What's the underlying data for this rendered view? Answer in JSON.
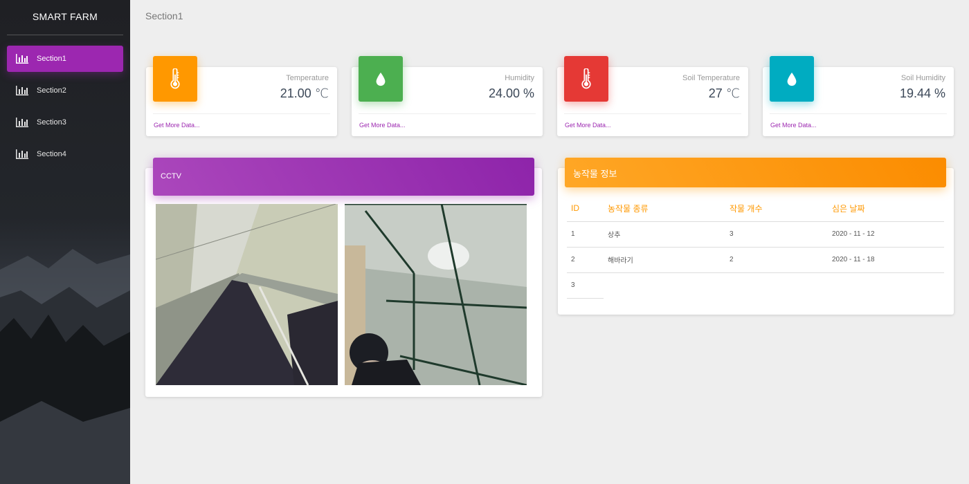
{
  "sidebar": {
    "brand": "SMART FARM",
    "items": [
      {
        "label": "Section1",
        "icon": "bar-chart-icon",
        "active": true
      },
      {
        "label": "Section2",
        "icon": "bar-chart-icon",
        "active": false
      },
      {
        "label": "Section3",
        "icon": "bar-chart-icon",
        "active": false
      },
      {
        "label": "Section4",
        "icon": "bar-chart-icon",
        "active": false
      }
    ]
  },
  "header": {
    "title": "Section1"
  },
  "stats": [
    {
      "label": "Temperature",
      "value": "21.00 ℃",
      "icon": "thermometer-icon",
      "color": "#ff9800",
      "link": "Get More Data..."
    },
    {
      "label": "Humidity",
      "value": "24.00 %",
      "icon": "water-drop-icon",
      "color": "#4caf50",
      "link": "Get More Data..."
    },
    {
      "label": "Soil Temperature",
      "value": "27 ℃",
      "icon": "thermometer-icon",
      "color": "#e53935",
      "link": "Get More Data..."
    },
    {
      "label": "Soil Humidity",
      "value": "19.44 %",
      "icon": "water-drop-icon",
      "color": "#00acc1",
      "link": "Get More Data..."
    }
  ],
  "cctv": {
    "title": "CCTV"
  },
  "crops": {
    "title": "농작물 정보",
    "columns": [
      "ID",
      "농작물 종류",
      "작물 개수",
      "심은 날짜"
    ],
    "rows": [
      [
        "1",
        "상추",
        "3",
        "2020 - 11 - 12"
      ],
      [
        "2",
        "해바라기",
        "2",
        "2020 - 11 - 18"
      ],
      [
        "3",
        "",
        "",
        ""
      ]
    ]
  },
  "colors": {
    "accent": "#9c27b0",
    "crop_header": "#ff9800"
  }
}
